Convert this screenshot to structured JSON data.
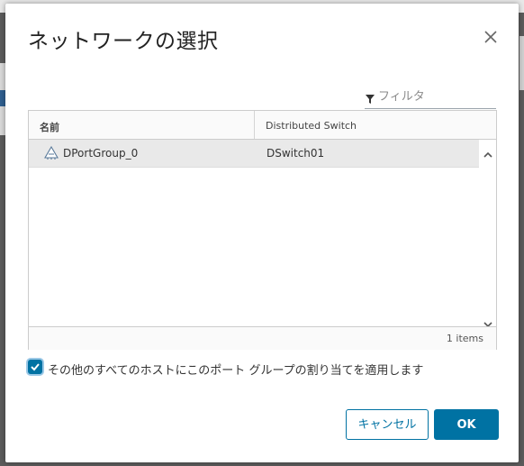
{
  "dialog": {
    "title": "ネットワークの選択",
    "close_icon": "close-icon"
  },
  "filter": {
    "placeholder": "フィルタ",
    "value": "",
    "icon": "filter-icon"
  },
  "grid": {
    "columns": [
      "名前",
      "Distributed Switch"
    ],
    "rows": [
      {
        "name": "DPortGroup_0",
        "switch": "DSwitch01",
        "icon": "port-group-icon",
        "selected": true
      }
    ],
    "footer": "1 items"
  },
  "apply_all": {
    "checked": true,
    "label": "その他のすべてのホストにこのポート グループの割り当てを適用します"
  },
  "buttons": {
    "cancel": "キャンセル",
    "ok": "OK"
  },
  "colors": {
    "accent": "#0072a3",
    "selected_row": "#e9e9e9"
  }
}
